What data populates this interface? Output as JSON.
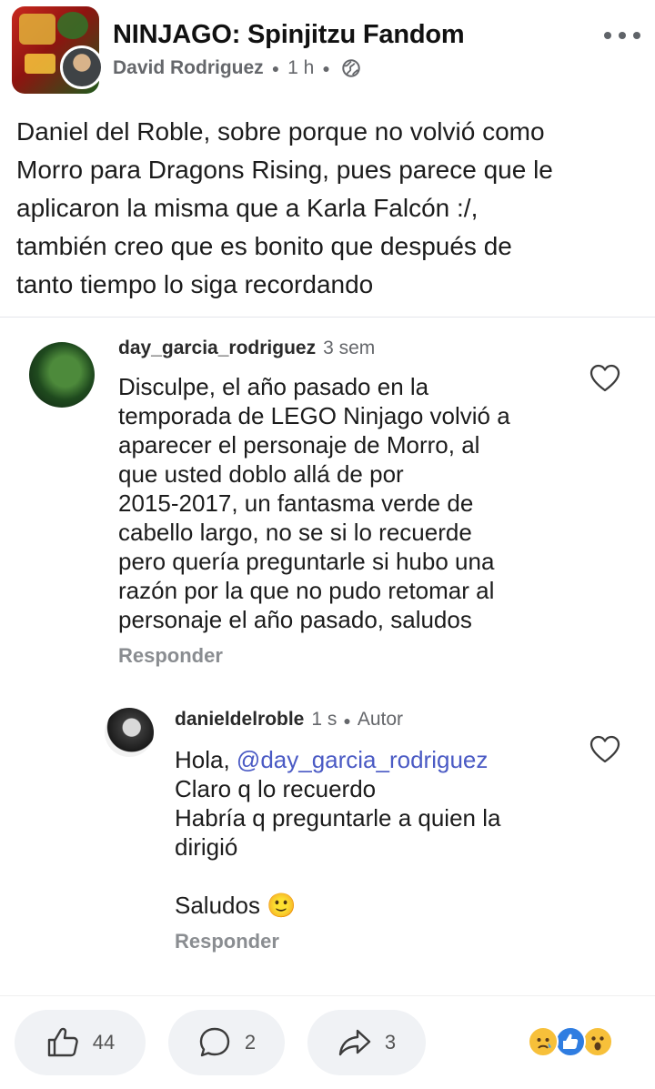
{
  "header": {
    "group_name": "NINJAGO: Spinjitzu Fandom",
    "author": "David Rodriguez",
    "time": "1 h"
  },
  "post": {
    "text": "Daniel del Roble, sobre porque no volvió como\nMorro para Dragons Rising, pues parece que le\naplicaron la misma que a Karla Falcón :/,\ntambién creo que es bonito que después de\ntanto tiempo lo siga recordando"
  },
  "comments": [
    {
      "username": "day_garcia_rodriguez",
      "time": "3 sem",
      "text": "Disculpe, el año pasado en la\ntemporada de LEGO Ninjago volvió a\naparecer el personaje de Morro, al\nque usted doblo allá de por\n2015-2017, un fantasma verde de\ncabello largo, no se si lo recuerde\npero quería preguntarle si hubo una\nrazón por la que no pudo retomar al\npersonaje el año pasado, saludos",
      "reply_label": "Responder"
    },
    {
      "username": "danieldelroble",
      "time": "1 s",
      "badge": "Autor",
      "greeting": "Hola, ",
      "mention": "@day_garcia_rodriguez",
      "text": "Claro q lo recuerdo\nHabría q preguntarle a quien la\ndirigió\n\nSaludos 🙂",
      "reply_label": "Responder"
    }
  ],
  "footer": {
    "likes": "44",
    "comments": "2",
    "shares": "3"
  },
  "icons": {
    "header": [
      "group-avatar",
      "user-avatar",
      "globe-icon",
      "more-icon"
    ],
    "footer": [
      "like-icon",
      "comment-icon",
      "share-icon",
      "sad-reaction-icon",
      "like-reaction-icon",
      "wow-reaction-icon"
    ]
  },
  "colors": {
    "mention": "#4a5ac4",
    "meta_gray": "#65676b",
    "pill_bg": "#f0f2f5"
  }
}
